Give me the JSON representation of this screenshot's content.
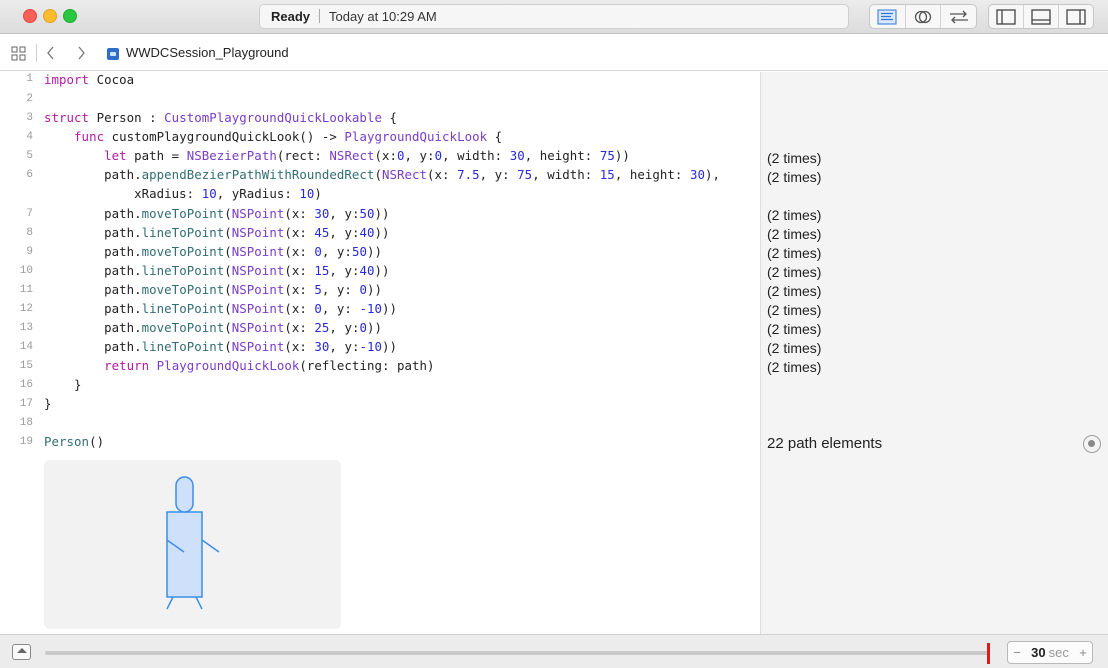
{
  "window": {
    "status": "Ready",
    "timestamp": "Today at 10:29 AM",
    "editor_buttons": [
      "standard-editor-icon",
      "assistant-editor-icon",
      "version-editor-icon"
    ],
    "view_buttons": [
      "navigator-toggle-icon",
      "debug-area-toggle-icon",
      "utilities-toggle-icon"
    ]
  },
  "jumpbar": {
    "grid_icon": "related-items-icon",
    "back": "‹",
    "forward": "›",
    "file_name": "WWDCSession_Playground"
  },
  "editor": {
    "line_numbers": [
      "1",
      "2",
      "3",
      "4",
      "5",
      "6",
      "7",
      "8",
      "9",
      "10",
      "11",
      "12",
      "13",
      "14",
      "15",
      "16",
      "17",
      "18",
      "19"
    ],
    "lines": [
      "import Cocoa",
      "",
      "struct Person : CustomPlaygroundQuickLookable {",
      "    func customPlaygroundQuickLook() -> PlaygroundQuickLook {",
      "        let path = NSBezierPath(rect: NSRect(x:0, y:0, width: 30, height: 75))",
      "        path.appendBezierPathWithRoundedRect(NSRect(x: 7.5, y: 75, width: 15, height: 30),",
      "            xRadius: 10, yRadius: 10)",
      "        path.moveToPoint(NSPoint(x: 30, y:50))",
      "        path.lineToPoint(NSPoint(x: 45, y:40))",
      "        path.moveToPoint(NSPoint(x: 0, y:50))",
      "        path.lineToPoint(NSPoint(x: 15, y:40))",
      "        path.moveToPoint(NSPoint(x: 5, y: 0))",
      "        path.lineToPoint(NSPoint(x: 0, y: -10))",
      "        path.moveToPoint(NSPoint(x: 25, y:0))",
      "        path.lineToPoint(NSPoint(x: 30, y:-10))",
      "        return PlaygroundQuickLook(reflecting: path)",
      "    }",
      "}",
      "",
      "Person()"
    ]
  },
  "results": {
    "repeat_label": "(2 times)",
    "person_result": "22 path elements",
    "quicklook_icon": "quick-look-icon"
  },
  "timeline": {
    "duration_value": "30",
    "duration_unit": "sec",
    "decrement": "−",
    "increment": "+"
  }
}
